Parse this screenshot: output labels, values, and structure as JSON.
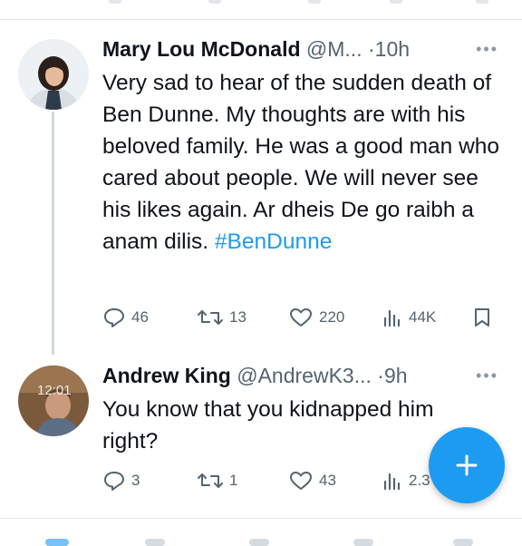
{
  "tweets": [
    {
      "name": "Mary Lou McDonald",
      "handle": "@M...",
      "separator": "·",
      "time": "10h",
      "more_icon": "more-horizontal-icon",
      "text": "Very sad to hear of the sudden death of Ben Dunne. My thoughts are with his beloved family. He was a good man who cared about people. We will never see his likes again. Ar dheis De go raibh a anam dilis. ",
      "hashtag": "#BenDunne",
      "replies": "46",
      "retweets": "13",
      "likes": "220",
      "views": "44K"
    },
    {
      "name": "Andrew King",
      "handle": "@AndrewK3...",
      "separator": "·",
      "time": "9h",
      "more_icon": "more-horizontal-icon",
      "text": "You know that you kidnapped him right?",
      "avatar_overlay": "12:01",
      "replies": "3",
      "retweets": "1",
      "likes": "43",
      "views": "2.3"
    }
  ],
  "compose_button_icon": "plus-icon",
  "colors": {
    "accent": "#1d9bf0",
    "secondary_text": "#536471",
    "text": "#0f1419"
  }
}
